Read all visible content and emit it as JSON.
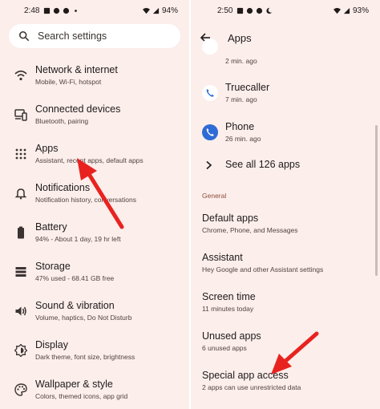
{
  "left": {
    "status": {
      "time": "2:48",
      "battery": "94%"
    },
    "search": {
      "placeholder": "Search settings"
    },
    "items": [
      {
        "title": "Network & internet",
        "subtitle": "Mobile, Wi-Fi, hotspot",
        "icon": "wifi-icon"
      },
      {
        "title": "Connected devices",
        "subtitle": "Bluetooth, pairing",
        "icon": "connected-devices-icon"
      },
      {
        "title": "Apps",
        "subtitle": "Assistant, recent apps, default apps",
        "icon": "apps-grid-icon"
      },
      {
        "title": "Notifications",
        "subtitle": "Notification history, conversations",
        "icon": "bell-icon"
      },
      {
        "title": "Battery",
        "subtitle": "94% - About 1 day, 19 hr left",
        "icon": "battery-icon"
      },
      {
        "title": "Storage",
        "subtitle": "47% used - 68.41 GB free",
        "icon": "storage-icon"
      },
      {
        "title": "Sound & vibration",
        "subtitle": "Volume, haptics, Do Not Disturb",
        "icon": "volume-icon"
      },
      {
        "title": "Display",
        "subtitle": "Dark theme, font size, brightness",
        "icon": "brightness-icon"
      },
      {
        "title": "Wallpaper & style",
        "subtitle": "Colors, themed icons, app grid",
        "icon": "palette-icon"
      }
    ]
  },
  "right": {
    "status": {
      "time": "2:50",
      "battery": "93%"
    },
    "title": "Apps",
    "recent_apps": [
      {
        "name": "",
        "time": "2 min. ago",
        "icon": "app-icon"
      },
      {
        "name": "Truecaller",
        "time": "7 min. ago",
        "icon": "truecaller-icon"
      },
      {
        "name": "Phone",
        "time": "26 min. ago",
        "icon": "phone-icon"
      }
    ],
    "see_all": "See all 126 apps",
    "section_general": "General",
    "general_items": [
      {
        "title": "Default apps",
        "subtitle": "Chrome, Phone, and Messages"
      },
      {
        "title": "Assistant",
        "subtitle": "Hey Google and other Assistant settings"
      },
      {
        "title": "Screen time",
        "subtitle": "11 minutes today"
      },
      {
        "title": "Unused apps",
        "subtitle": "6 unused apps"
      },
      {
        "title": "Special app access",
        "subtitle": "2 apps can use unrestricted data"
      }
    ]
  },
  "colors": {
    "background": "#fbeeeb",
    "annotation_arrow": "#e8231f",
    "section_header": "#8f4c38",
    "phone_icon": "#2f6bd6"
  }
}
